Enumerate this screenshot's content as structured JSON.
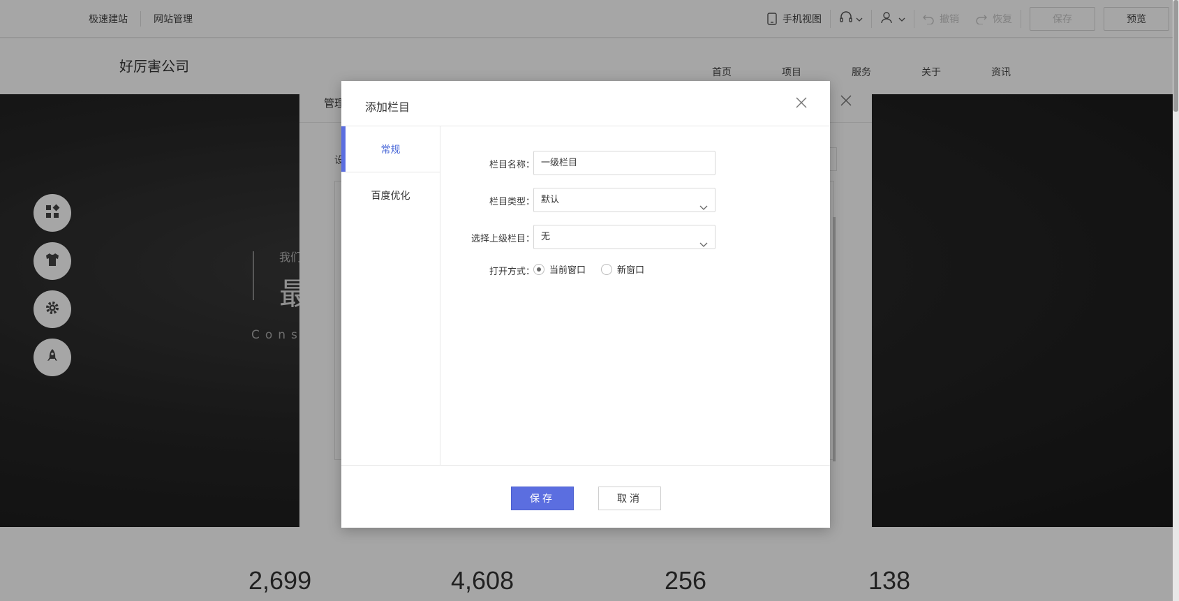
{
  "topbar": {
    "left_links": [
      "极速建站",
      "网站管理"
    ],
    "mobile_view": "手机视图",
    "undo": "撤销",
    "redo": "恢复",
    "save": "保存",
    "preview": "预览"
  },
  "site": {
    "logo": "好厉害公司",
    "nav": [
      "首页",
      "项目",
      "服务",
      "关于",
      "资讯"
    ],
    "hero_small": "我们",
    "hero_big": "最",
    "hero_en": "Cons",
    "stats": [
      "2,699",
      "4,608",
      "256",
      "138"
    ]
  },
  "background_dialog": {
    "title": "管理",
    "tab": "设"
  },
  "dialog": {
    "title": "添加栏目",
    "tabs": [
      {
        "label": "常规",
        "active": true
      },
      {
        "label": "百度优化",
        "active": false
      }
    ],
    "fields": {
      "name": {
        "label": "栏目名称：",
        "value": "一级栏目"
      },
      "type": {
        "label": "栏目类型：",
        "value": "默认"
      },
      "parent": {
        "label": "选择上级栏目：",
        "value": "无"
      },
      "open_mode": {
        "label": "打开方式：",
        "options": [
          {
            "label": "当前窗口",
            "checked": true
          },
          {
            "label": "新窗口",
            "checked": false
          }
        ]
      }
    },
    "save_button": "保存",
    "cancel_button": "取消"
  },
  "colors": {
    "primary": "#5b6ee0",
    "active_tab_text": "#4d6bd8",
    "overlay": "rgba(0,0,0,0.35)"
  }
}
